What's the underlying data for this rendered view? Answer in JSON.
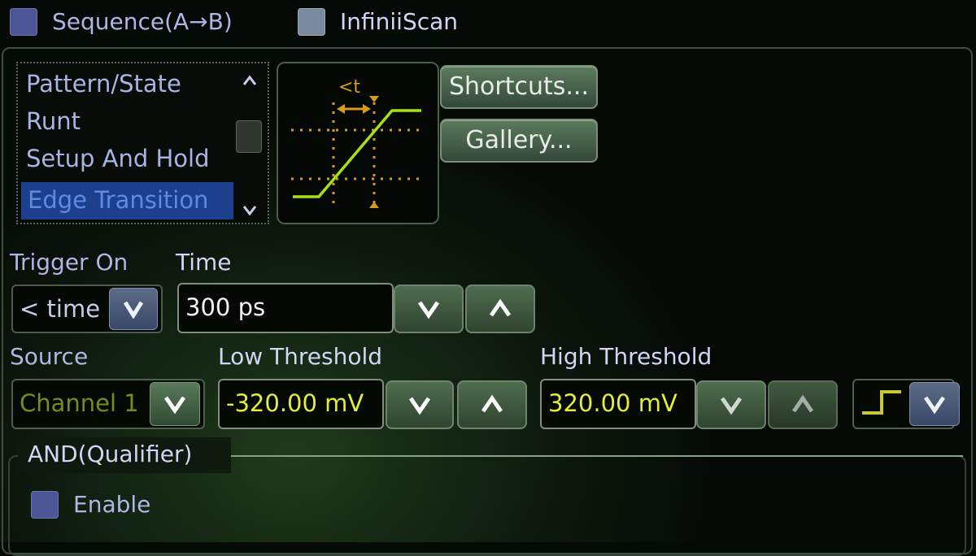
{
  "top": {
    "sequence_label": "Sequence(A→B)",
    "infiniiscan_label": "InfiniiScan"
  },
  "trigger_list": {
    "items": [
      "Pattern/State",
      "Runt",
      "Setup And Hold",
      "Edge Transition"
    ],
    "selected": "Edge Transition"
  },
  "preview": {
    "caption": "<t",
    "icon": "edge-transition-waveform-icon"
  },
  "buttons": {
    "shortcuts": "Shortcuts...",
    "gallery": "Gallery..."
  },
  "trigger_on": {
    "label": "Trigger On",
    "value": "< time"
  },
  "time": {
    "label": "Time",
    "value": "300 ps"
  },
  "source": {
    "label": "Source",
    "value": "Channel 1"
  },
  "low_threshold": {
    "label": "Low Threshold",
    "value": "-320.00 mV"
  },
  "high_threshold": {
    "label": "High Threshold",
    "value": "320.00 mV"
  },
  "slope": {
    "icon": "rising-edge-icon"
  },
  "qualifier": {
    "title": "AND(Qualifier)",
    "enable_label": "Enable"
  },
  "colors": {
    "accent_green": "#a8e018",
    "marker_orange": "#e0a020",
    "value_yellow": "#e4ec3c",
    "selection_blue": "#1c3f8e"
  }
}
